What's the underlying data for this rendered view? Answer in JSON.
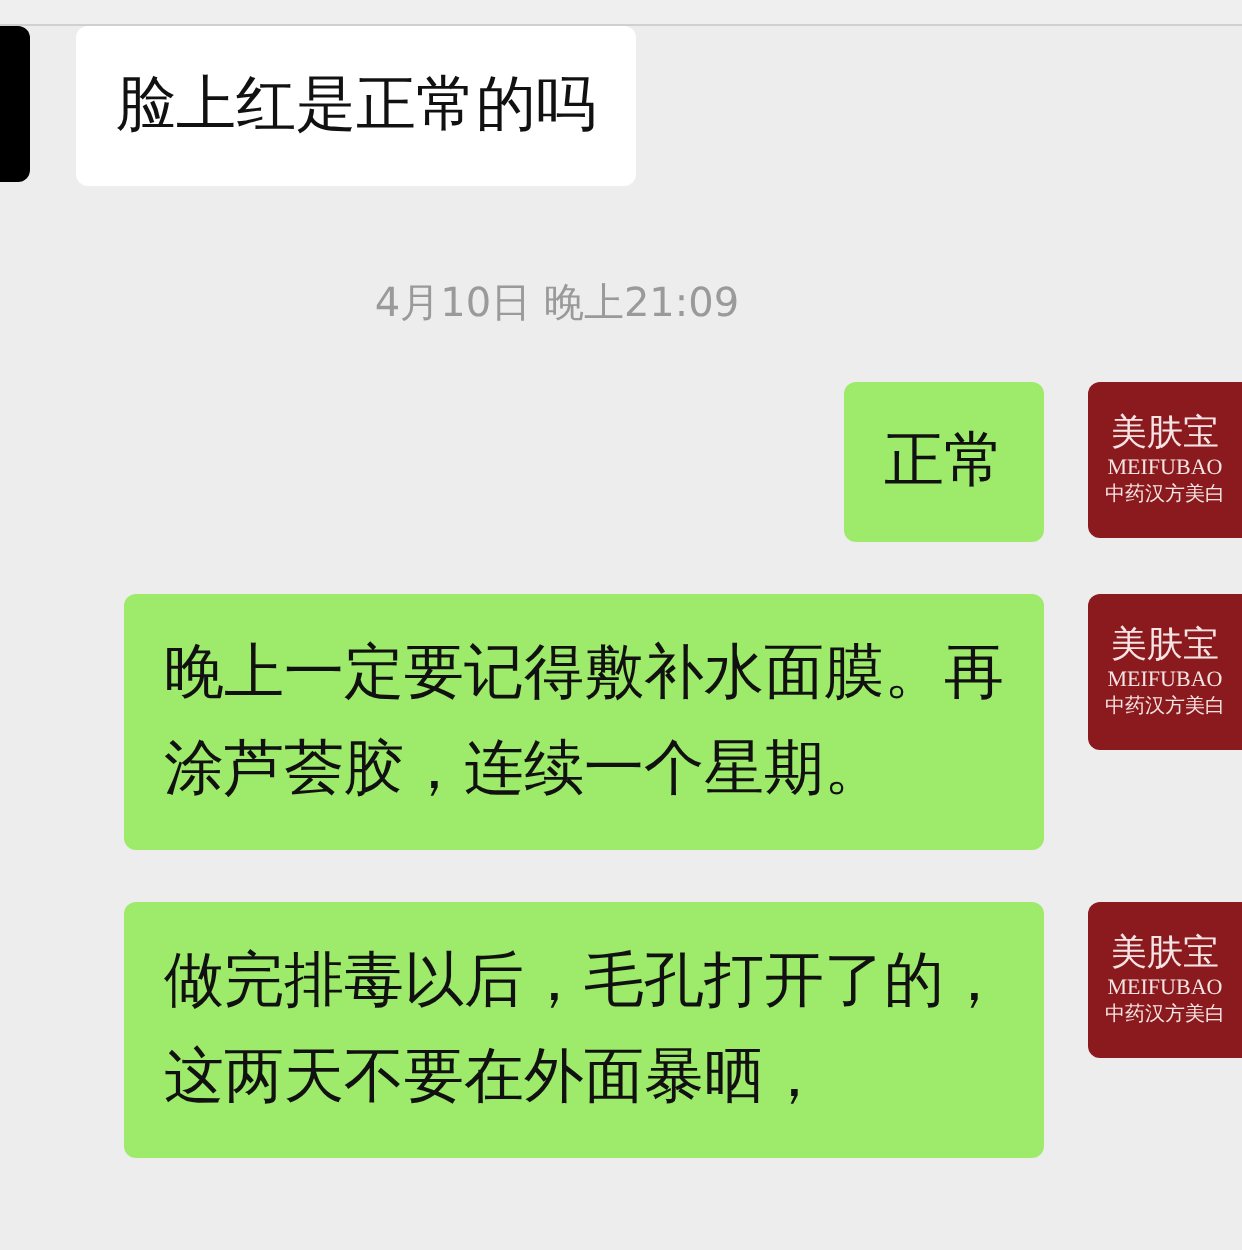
{
  "messages": [
    {
      "kind": "incoming",
      "lines": [
        "脸上红是正常的吗"
      ]
    },
    {
      "kind": "time",
      "text": "4月10日 晚上21:09"
    },
    {
      "kind": "outgoing",
      "lines": [
        "正常"
      ],
      "avatar": {
        "brand": "美肤宝",
        "latin": "MEIFUBAO",
        "tagline": "中药汉方美白"
      }
    },
    {
      "kind": "outgoing",
      "lines": [
        "晚上一定要记得敷补水面膜。再",
        "涂芦荟胶，连续一个星期。"
      ],
      "avatar": {
        "brand": "美肤宝",
        "latin": "MEIFUBAO",
        "tagline": "中药汉方美白"
      }
    },
    {
      "kind": "outgoing",
      "lines": [
        "做完排毒以后，毛孔打开了的，",
        "这两天不要在外面暴晒，"
      ],
      "avatar": {
        "brand": "美肤宝",
        "latin": "MEIFUBAO",
        "tagline": "中药汉方美白"
      }
    }
  ]
}
